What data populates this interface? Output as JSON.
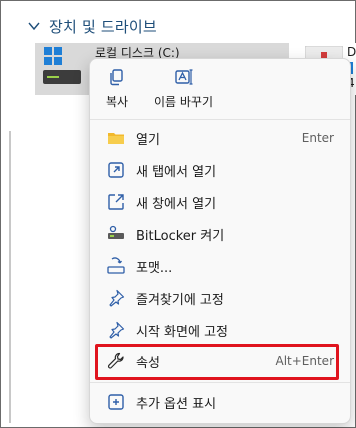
{
  "section": {
    "title": "장치 및 드라이브"
  },
  "drives": [
    {
      "name": "로컬 디스크 (C:)"
    },
    {
      "name_partial": "D",
      "name_partial_2": "4"
    }
  ],
  "quick_actions": [
    {
      "label": "복사",
      "icon": "copy-icon"
    },
    {
      "label": "이름 바꾸기",
      "icon": "rename-icon"
    }
  ],
  "menu_items": [
    {
      "label": "열기",
      "shortcut": "Enter",
      "icon": "folder-open-icon"
    },
    {
      "label": "새 탭에서 열기",
      "shortcut": "",
      "icon": "open-new-tab-icon"
    },
    {
      "label": "새 창에서 열기",
      "shortcut": "",
      "icon": "open-new-window-icon"
    },
    {
      "label": "BitLocker 켜기",
      "shortcut": "",
      "icon": "bitlocker-key-icon"
    },
    {
      "label": "포맷...",
      "shortcut": "",
      "icon": "format-icon"
    },
    {
      "label": "즐겨찾기에 고정",
      "shortcut": "",
      "icon": "pin-icon"
    },
    {
      "label": "시작 화면에 고정",
      "shortcut": "",
      "icon": "pin-icon"
    },
    {
      "label": "속성",
      "shortcut": "Alt+Enter",
      "icon": "wrench-icon"
    },
    {
      "label": "추가 옵션 표시",
      "shortcut": "",
      "icon": "more-options-icon"
    }
  ],
  "colors": {
    "highlight_border": "#e0141e",
    "section_title": "#1e4e79",
    "windows_blue": "#1f7fd6",
    "selected_tile": "#d9d9d9"
  }
}
